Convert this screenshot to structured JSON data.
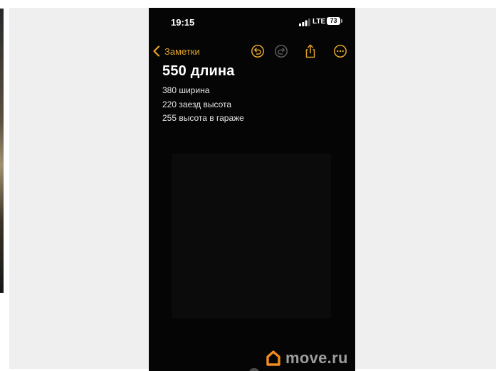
{
  "status_bar": {
    "time": "19:15",
    "network": "LTE",
    "battery": "73",
    "signal_icon": "signal-bars-icon"
  },
  "nav": {
    "back_label": "Заметки",
    "back_icon": "chevron-left-icon",
    "actions": [
      "undo-icon",
      "redo-icon",
      "share-icon",
      "more-icon"
    ]
  },
  "note": {
    "title": "550 длина",
    "lines": [
      "380 ширина",
      "220 заезд высота",
      "255 высота в гараже"
    ]
  },
  "watermark": {
    "text": "move.ru",
    "icon": "house-icon"
  },
  "colors": {
    "accent": "#e3a52a",
    "background": "#050505",
    "page_frame": "#efefef",
    "watermark_orange": "#f28c1e"
  }
}
